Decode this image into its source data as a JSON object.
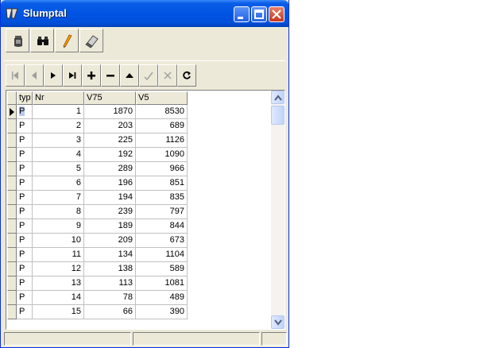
{
  "window": {
    "title": "Slumptal"
  },
  "table": {
    "columns": [
      "typ",
      "Nr",
      "V75",
      "V5"
    ],
    "rows": [
      [
        "P",
        "1",
        "1870",
        "8530"
      ],
      [
        "P",
        "2",
        "203",
        "689"
      ],
      [
        "P",
        "3",
        "225",
        "1126"
      ],
      [
        "P",
        "4",
        "192",
        "1090"
      ],
      [
        "P",
        "5",
        "289",
        "966"
      ],
      [
        "P",
        "6",
        "196",
        "851"
      ],
      [
        "P",
        "7",
        "194",
        "835"
      ],
      [
        "P",
        "8",
        "239",
        "797"
      ],
      [
        "P",
        "9",
        "189",
        "844"
      ],
      [
        "P",
        "10",
        "209",
        "673"
      ],
      [
        "P",
        "11",
        "134",
        "1104"
      ],
      [
        "P",
        "12",
        "138",
        "589"
      ],
      [
        "P",
        "13",
        "113",
        "1081"
      ],
      [
        "P",
        "14",
        "78",
        "489"
      ],
      [
        "P",
        "15",
        "66",
        "390"
      ]
    ]
  }
}
